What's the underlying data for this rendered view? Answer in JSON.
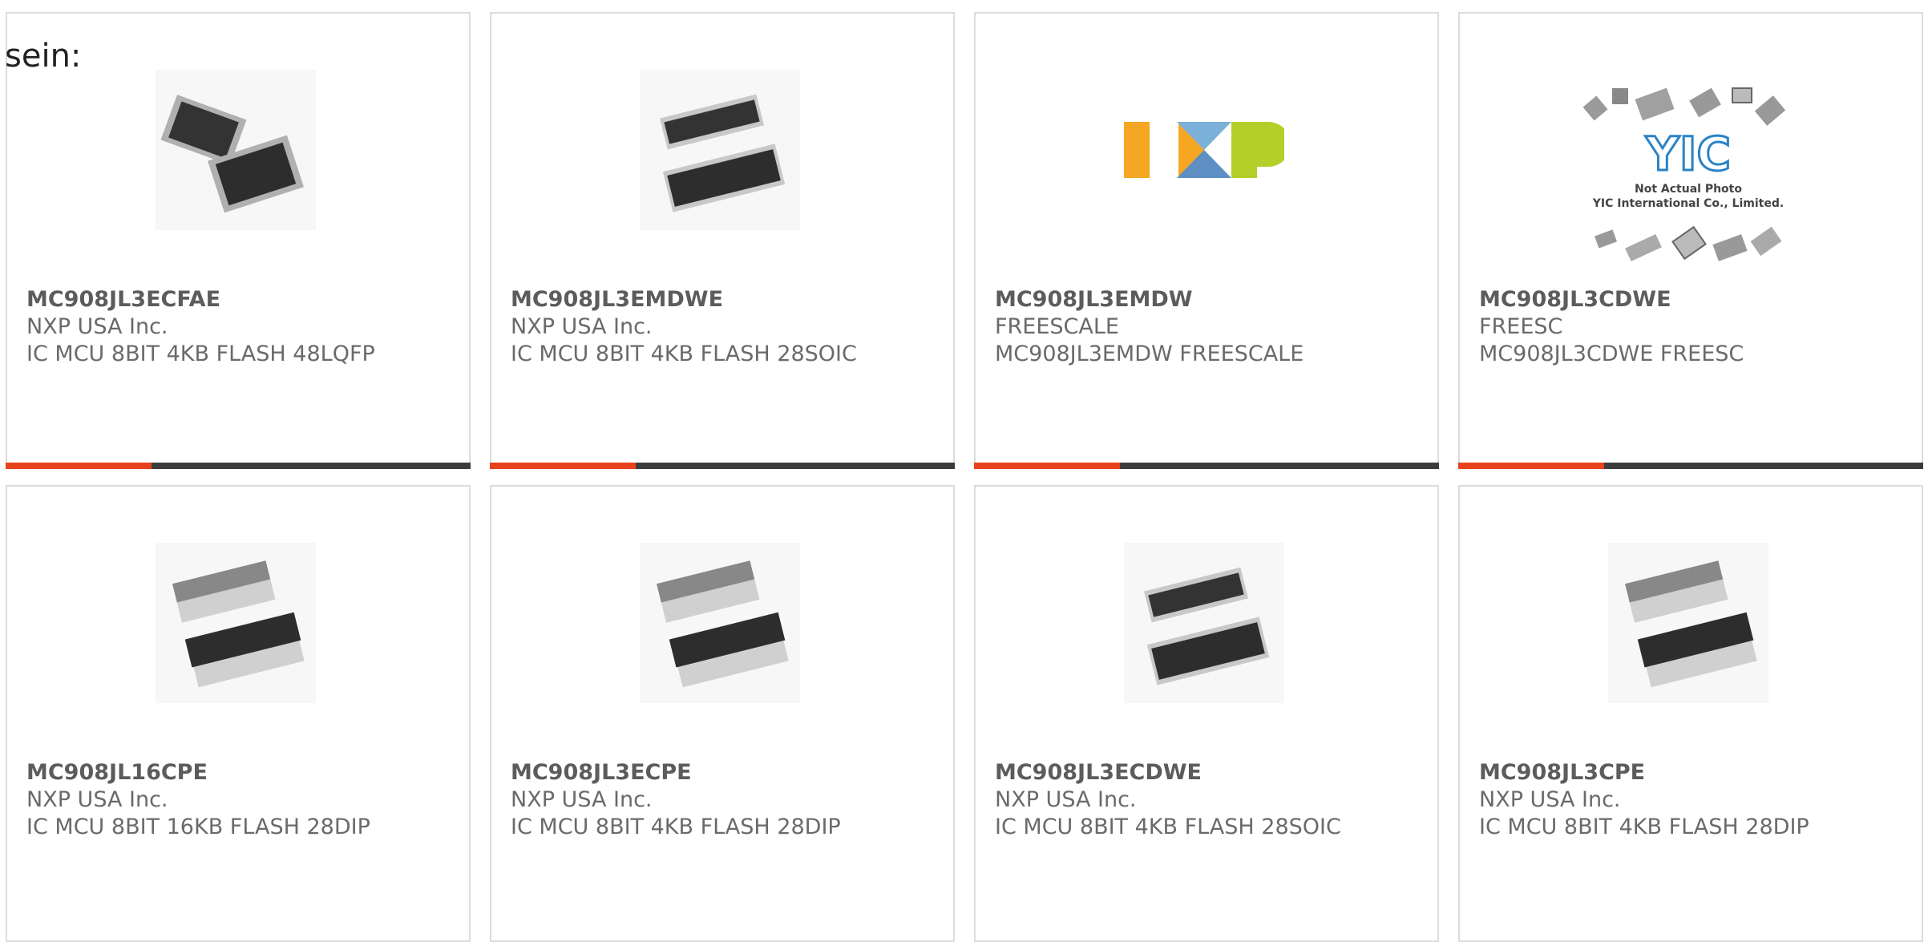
{
  "intro_text": "sein:",
  "colors": {
    "accent": "#e8421c",
    "bar": "#3c3c3c",
    "card_border": "#dcdcdc",
    "text": "#6a6a6a"
  },
  "logo_text": {
    "nxp": "NXP",
    "yic": "YIC",
    "yic_note_1": "Not Actual Photo",
    "yic_note_2": "YIC International Co., Limited."
  },
  "products": [
    {
      "part": "MC908JL3ECFAE",
      "maker": "NXP USA Inc.",
      "desc": "IC MCU 8BIT 4KB FLASH 48LQFP",
      "image": "lqfp-chip-icon"
    },
    {
      "part": "MC908JL3EMDWE",
      "maker": "NXP USA Inc.",
      "desc": "IC MCU 8BIT 4KB FLASH 28SOIC",
      "image": "soic-chip-icon"
    },
    {
      "part": "MC908JL3EMDW",
      "maker": "FREESCALE",
      "desc": "MC908JL3EMDW FREESCALE",
      "image": "nxp-logo"
    },
    {
      "part": "MC908JL3CDWE",
      "maker": "FREESC",
      "desc": "MC908JL3CDWE FREESC",
      "image": "yic-placeholder"
    },
    {
      "part": "MC908JL16CPE",
      "maker": "NXP USA Inc.",
      "desc": "IC MCU 8BIT 16KB FLASH 28DIP",
      "image": "dip-chip-icon"
    },
    {
      "part": "MC908JL3ECPE",
      "maker": "NXP USA Inc.",
      "desc": "IC MCU 8BIT 4KB FLASH 28DIP",
      "image": "dip-chip-icon"
    },
    {
      "part": "MC908JL3ECDWE",
      "maker": "NXP USA Inc.",
      "desc": "IC MCU 8BIT 4KB FLASH 28SOIC",
      "image": "soic-chip-icon"
    },
    {
      "part": "MC908JL3CPE",
      "maker": "NXP USA Inc.",
      "desc": "IC MCU 8BIT 4KB FLASH 28DIP",
      "image": "dip-chip-icon"
    }
  ]
}
